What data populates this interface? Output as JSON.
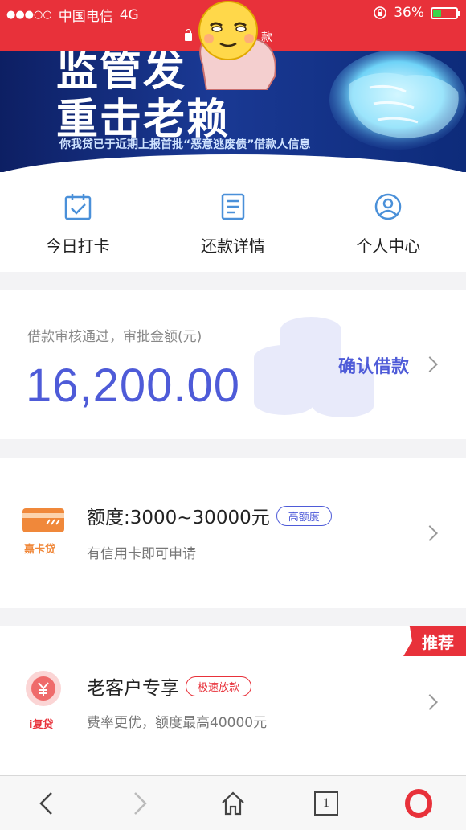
{
  "status_bar": {
    "signal": "●●●○○",
    "carrier": "中国电信",
    "network": "4G",
    "battery_percent": "36%",
    "battery_level": 0.36,
    "url_partial": "款"
  },
  "banner": {
    "line1": "监管发",
    "line2": "重击老赖",
    "subtitle": "你我贷已于近期上报首批“恶意逃废债”借款人信息"
  },
  "nav": [
    {
      "label": "今日打卡",
      "icon": "calendar-check-icon"
    },
    {
      "label": "还款详情",
      "icon": "document-icon"
    },
    {
      "label": "个人中心",
      "icon": "user-icon"
    }
  ],
  "loan": {
    "hint": "借款审核通过，审批金额(元)",
    "amount": "16,200.00",
    "confirm_label": "确认借款"
  },
  "products": [
    {
      "logo_name": "嘉卡贷",
      "title": "额度:3000~30000元",
      "tag": "高额度",
      "desc": "有信用卡即可申请"
    },
    {
      "logo_name": "i复贷",
      "title": "老客户专享",
      "tag": "极速放款",
      "desc": "费率更优，额度最高40000元",
      "badge": "推荐"
    }
  ],
  "toolbar": {
    "tab_count": "1"
  },
  "colors": {
    "brand_red": "#e8313a",
    "accent_blue": "#4e5bd8",
    "logo_orange": "#f0883a"
  }
}
